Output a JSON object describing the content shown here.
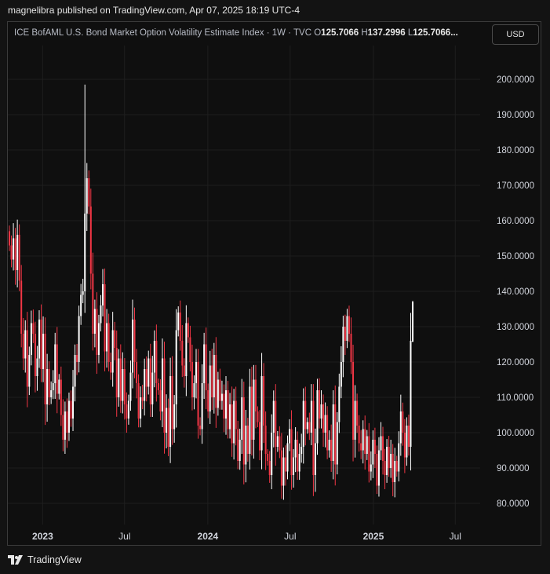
{
  "header": {
    "published": "magnelibra published on TradingView.com, Apr 07, 2025 18:19 UTC-4"
  },
  "legend": {
    "symbol": "ICE BofAML U.S. Bond Market Option Volatility Estimate Index · 1W · TVC",
    "o_label": "O",
    "o_value": "125.7066",
    "h_label": "H",
    "h_value": "137.2996",
    "l_label": "L",
    "l_value": "125.7066..."
  },
  "currency_button": "USD",
  "footer": {
    "brand": "TradingView"
  },
  "colors": {
    "up": "#ffffff",
    "down": "#f23645",
    "grid": "#1e1e1e",
    "text": "#d1d4dc"
  },
  "chart_data": {
    "type": "candlestick",
    "ylim": [
      75,
      205
    ],
    "y_ticks": [
      "200.0000",
      "190.0000",
      "180.0000",
      "170.0000",
      "160.0000",
      "150.0000",
      "140.0000",
      "130.0000",
      "120.0000",
      "110.0000",
      "100.0000",
      "90.0000",
      "80.0000"
    ],
    "x_ticks": [
      {
        "label": "2023",
        "date": "2023-01-01"
      },
      {
        "label": "Jul",
        "date": "2023-07-01"
      },
      {
        "label": "2024",
        "date": "2024-01-01"
      },
      {
        "label": "Jul",
        "date": "2024-07-01"
      },
      {
        "label": "2025",
        "date": "2025-01-01"
      },
      {
        "label": "Jul",
        "date": "2025-07-01"
      }
    ],
    "x_range": [
      "2022-10-16",
      "2025-08-25"
    ],
    "closes": [
      153,
      149,
      155,
      146,
      156,
      143,
      128,
      121,
      129,
      113,
      122,
      131,
      128,
      116,
      121,
      132,
      118,
      128,
      108,
      118,
      110,
      112,
      114,
      125,
      111,
      115,
      105,
      98,
      106,
      100,
      109,
      104,
      113,
      122,
      120,
      133,
      139,
      140,
      162,
      172,
      164,
      145,
      128,
      135,
      122,
      131,
      136,
      142,
      123,
      131,
      120,
      117,
      129,
      124,
      110,
      121,
      109,
      118,
      108,
      104,
      109,
      117,
      132,
      120,
      114,
      104,
      110,
      109,
      118,
      113,
      121,
      108,
      117,
      126,
      114,
      112,
      106,
      121,
      100,
      107,
      96,
      116,
      101,
      108,
      129,
      134,
      126,
      119,
      116,
      131,
      127,
      120,
      110,
      114,
      120,
      102,
      101,
      114,
      125,
      112,
      106,
      119,
      110,
      122,
      107,
      115,
      109,
      111,
      104,
      112,
      101,
      108,
      97,
      109,
      101,
      92,
      98,
      110,
      91,
      102,
      94,
      113,
      98,
      115,
      106,
      103,
      95,
      116,
      102,
      94,
      92,
      88,
      100,
      109,
      96,
      99,
      95,
      85,
      93,
      89,
      97,
      101,
      88,
      93,
      98,
      89,
      94,
      96,
      109,
      101,
      103,
      100,
      109,
      88,
      97,
      112,
      104,
      108,
      100,
      105,
      95,
      98,
      92,
      108,
      91,
      103,
      113,
      120,
      130,
      126,
      133,
      128,
      120,
      98,
      109,
      102,
      97,
      95,
      101,
      94,
      99,
      89,
      91,
      98,
      94,
      85,
      95,
      99,
      92,
      88,
      96,
      90,
      94,
      86,
      92,
      89,
      97,
      106,
      100,
      93,
      102,
      96,
      126,
      137
    ]
  }
}
